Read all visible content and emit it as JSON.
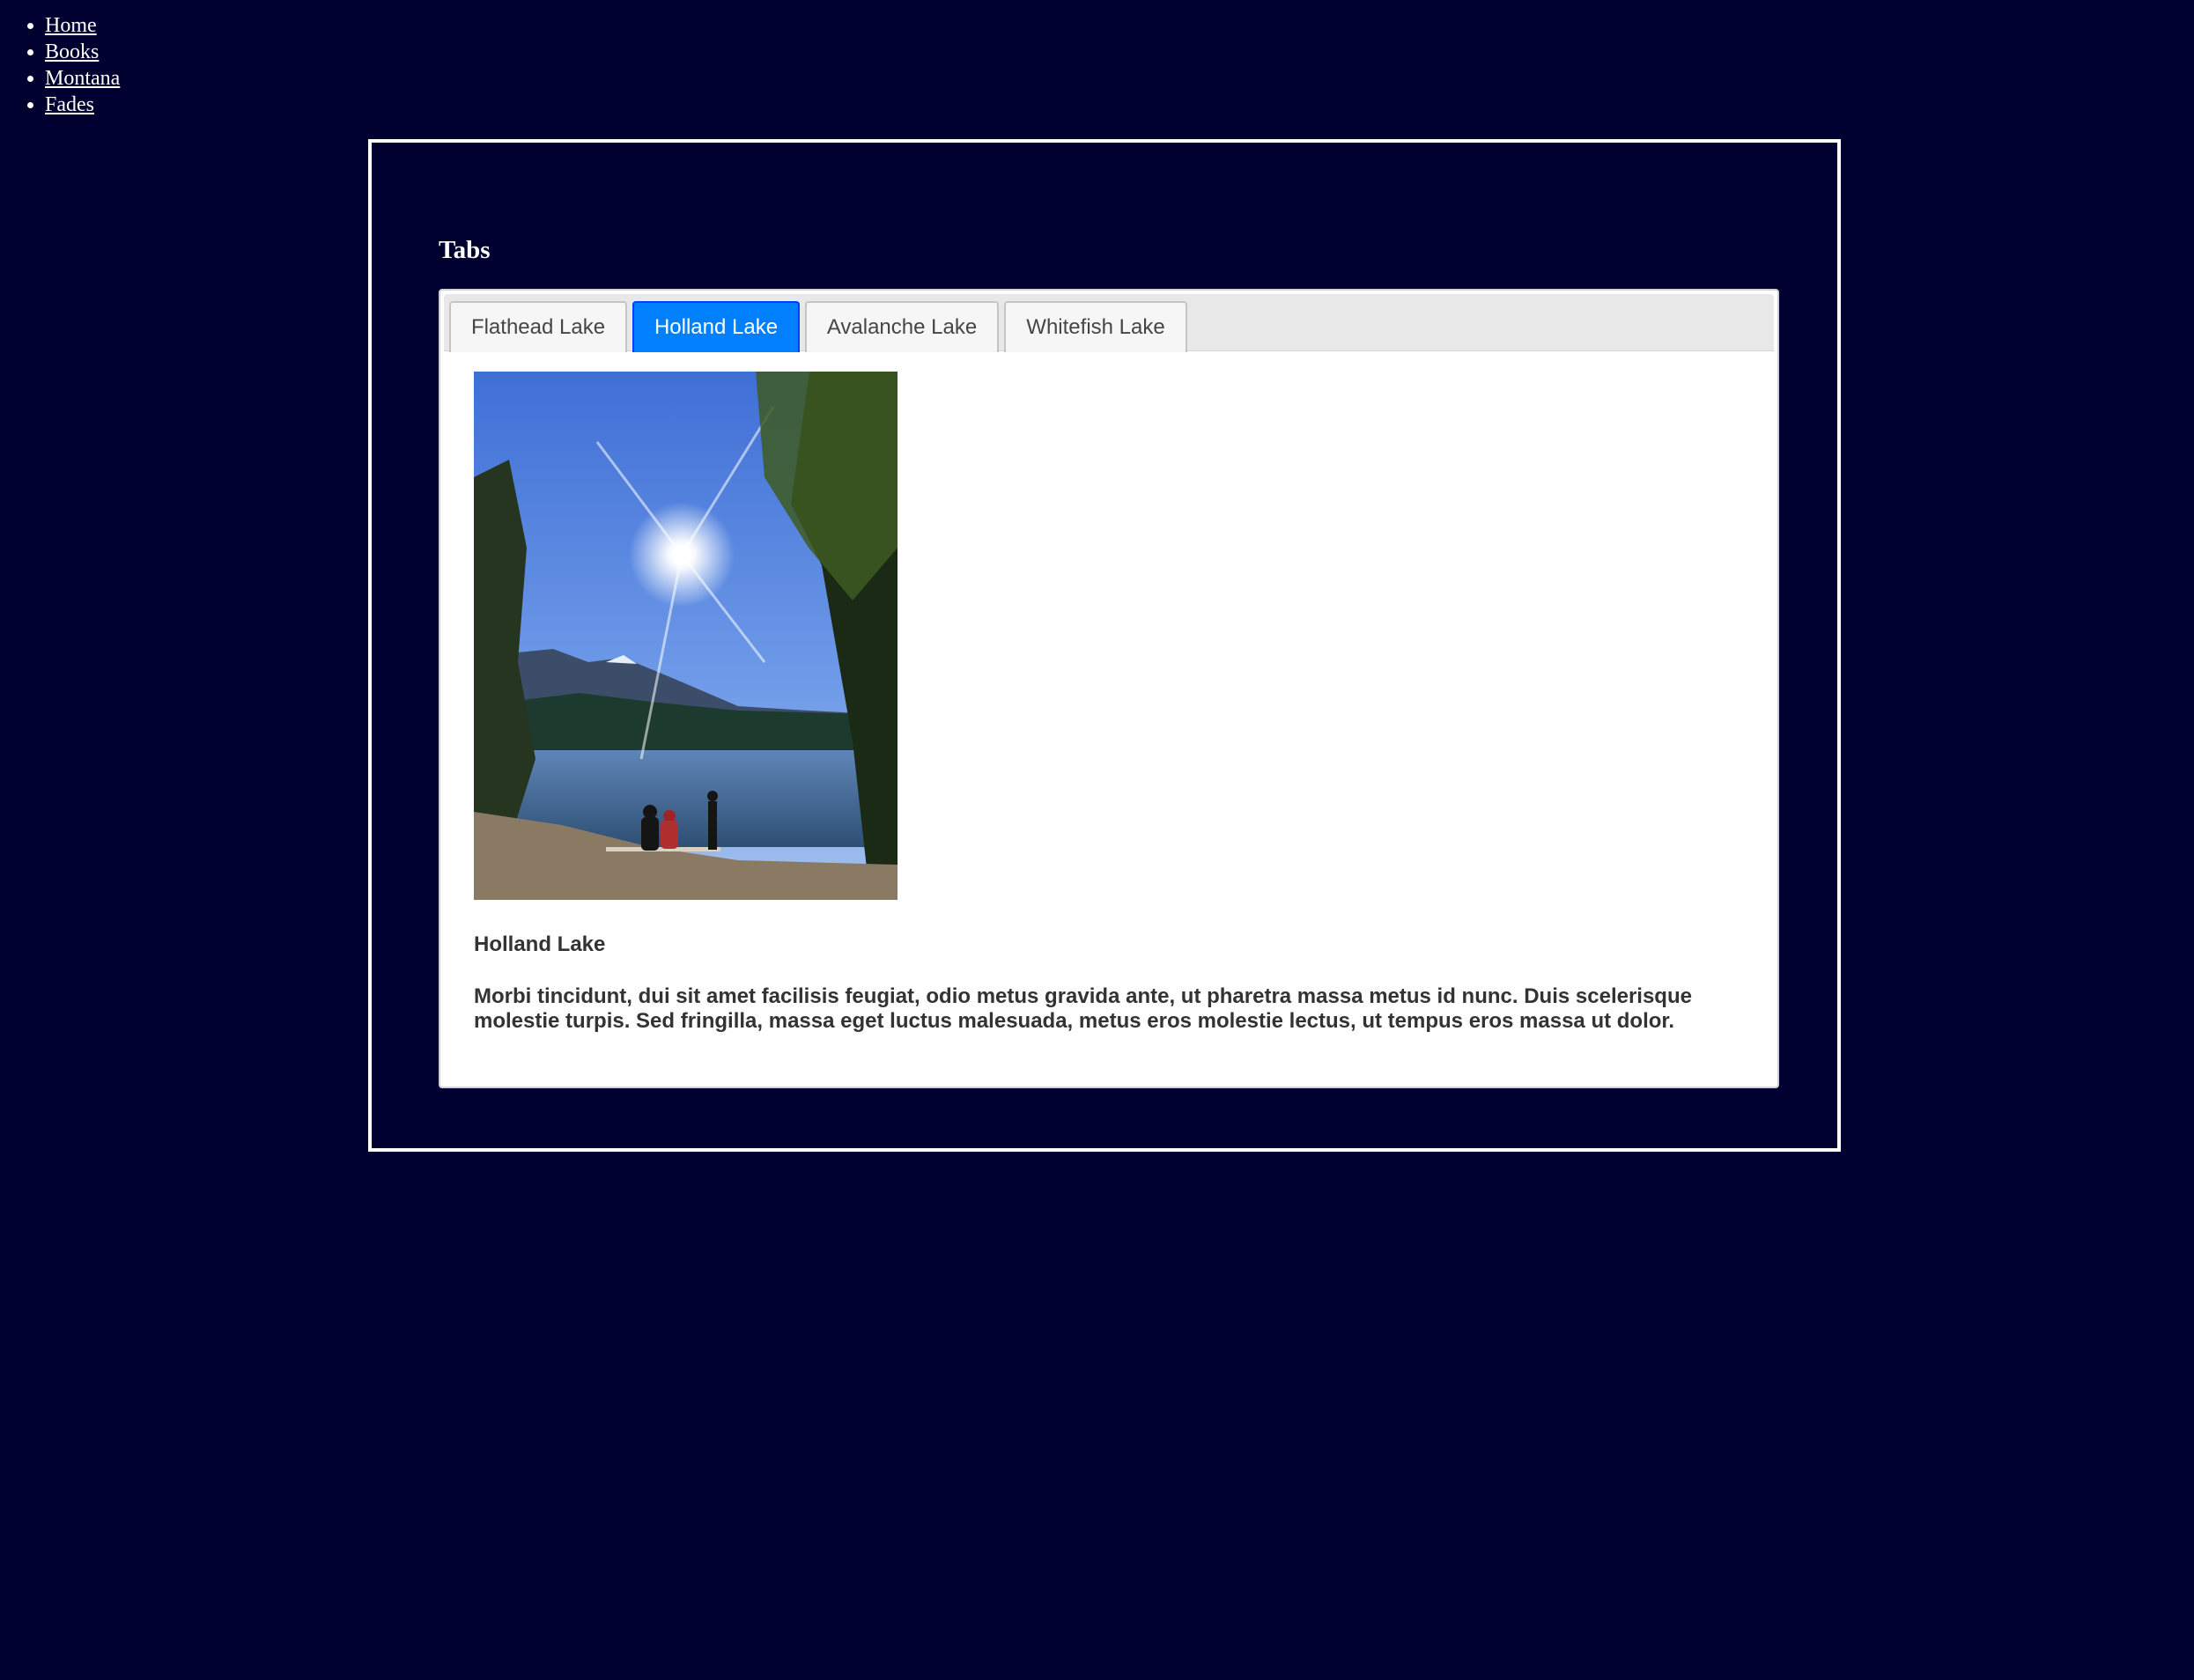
{
  "nav": {
    "items": [
      {
        "label": "Home"
      },
      {
        "label": "Books"
      },
      {
        "label": "Montana"
      },
      {
        "label": "Fades"
      }
    ]
  },
  "section": {
    "title": "Tabs"
  },
  "tabs": [
    {
      "label": "Flathead Lake",
      "active": false
    },
    {
      "label": "Holland Lake",
      "active": true
    },
    {
      "label": "Avalanche Lake",
      "active": false
    },
    {
      "label": "Whitefish Lake",
      "active": false
    }
  ],
  "panel": {
    "heading": "Holland Lake",
    "text": "Morbi tincidunt, dui sit amet facilisis feugiat, odio metus gravida ante, ut pharetra massa metus id nunc. Duis scelerisque molestie turpis. Sed fringilla, massa eget luctus malesuada, metus eros molestie lectus, ut tempus eros massa ut dolor."
  },
  "colors": {
    "page_background": "#000030",
    "active_tab": "#007fff",
    "frame_border": "#ffffff"
  }
}
